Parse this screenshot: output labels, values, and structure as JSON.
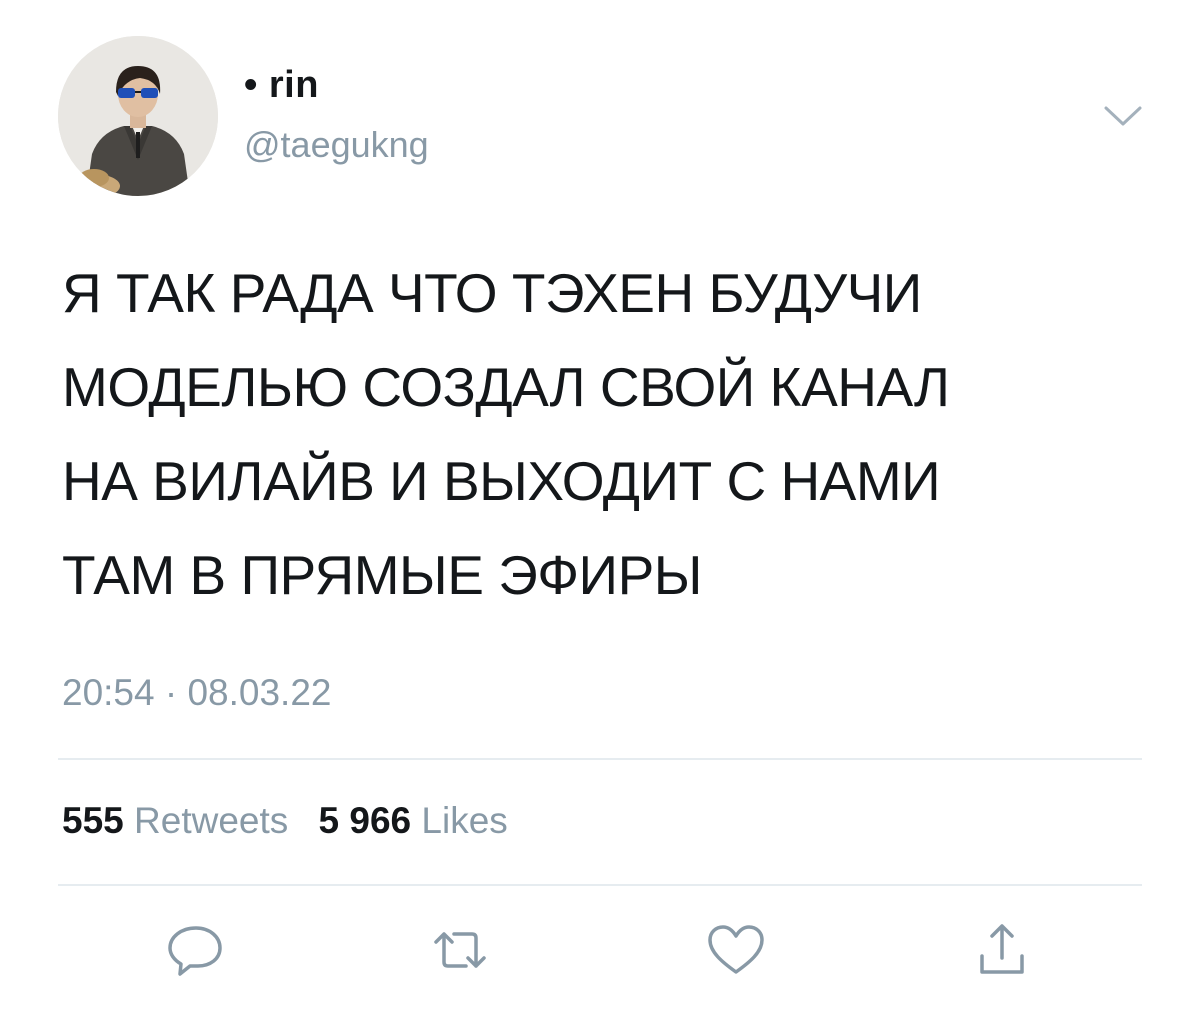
{
  "author": {
    "display_name": "• rin",
    "handle": "@taegukng",
    "avatar_icon": "profile-photo-man-in-suit-sunglasses"
  },
  "tweet": {
    "lines": [
      "Я ТАК РАДА ЧТО ТЭХЕН БУДУЧИ",
      "МОДЕЛЬЮ СОЗДАЛ СВОЙ КАНАЛ",
      "НА ВИЛАЙВ И ВЫХОДИТ С НАМИ",
      "ТАМ В ПРЯМЫЕ ЭФИРЫ"
    ],
    "timestamp": "20:54 · 08.03.22"
  },
  "stats": {
    "retweets_count": "555",
    "retweets_label": "Retweets",
    "likes_count": "5 966",
    "likes_label": "Likes"
  },
  "actions": {
    "reply_icon": "reply-icon",
    "retweet_icon": "retweet-icon",
    "like_icon": "heart-icon",
    "share_icon": "share-icon"
  },
  "colors": {
    "text": "#14171a",
    "secondary": "#8899a6",
    "divider": "#e6ecf0"
  }
}
